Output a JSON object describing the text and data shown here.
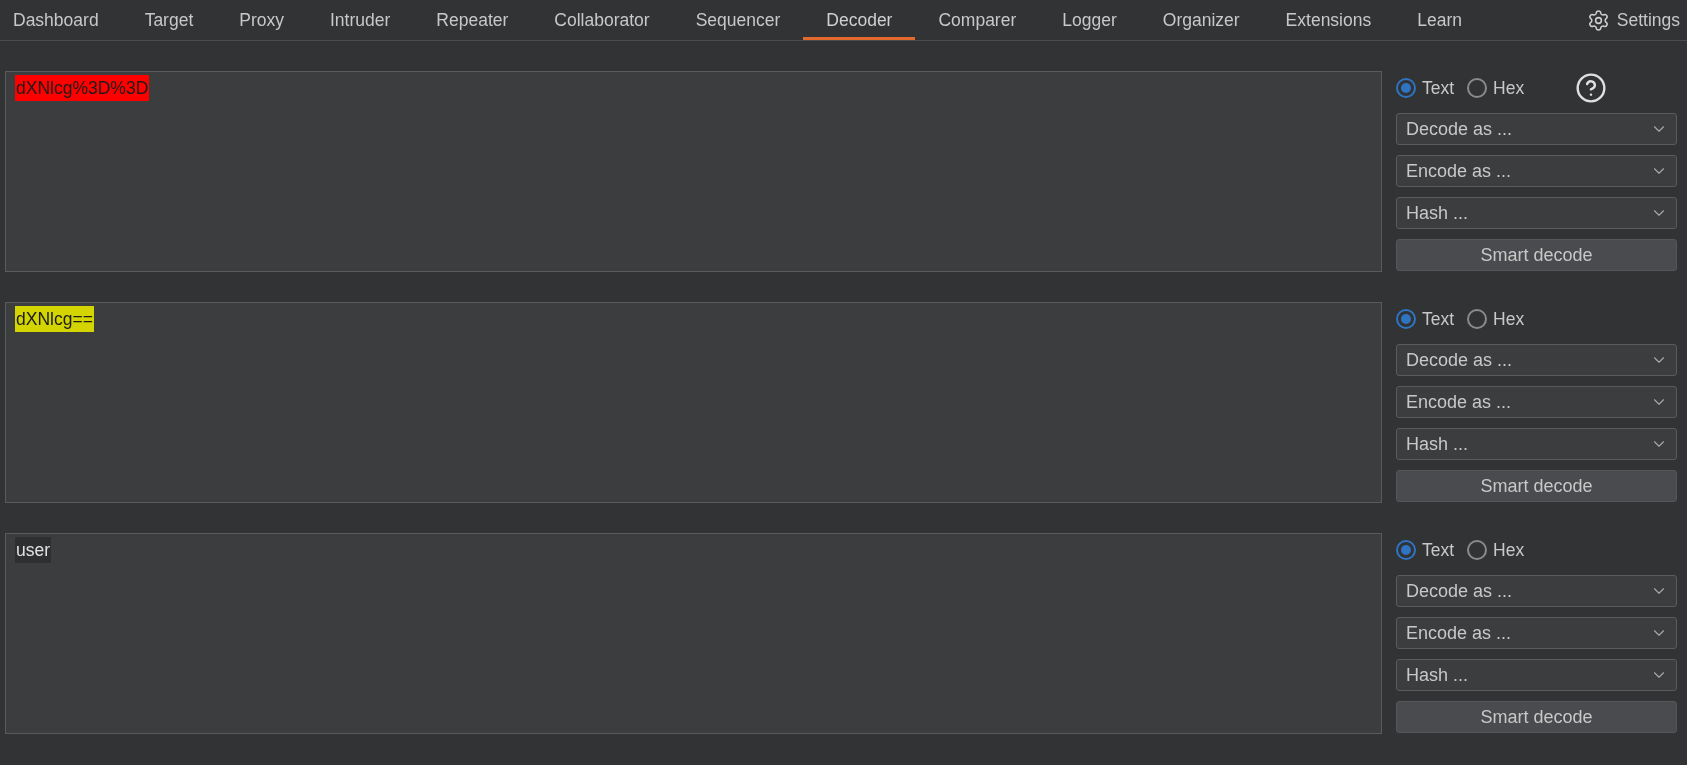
{
  "tabs": [
    {
      "label": "Dashboard",
      "selected": false
    },
    {
      "label": "Target",
      "selected": false
    },
    {
      "label": "Proxy",
      "selected": false
    },
    {
      "label": "Intruder",
      "selected": false
    },
    {
      "label": "Repeater",
      "selected": false
    },
    {
      "label": "Collaborator",
      "selected": false
    },
    {
      "label": "Sequencer",
      "selected": false
    },
    {
      "label": "Decoder",
      "selected": true
    },
    {
      "label": "Comparer",
      "selected": false
    },
    {
      "label": "Logger",
      "selected": false
    },
    {
      "label": "Organizer",
      "selected": false
    },
    {
      "label": "Extensions",
      "selected": false
    },
    {
      "label": "Learn",
      "selected": false
    }
  ],
  "settings": {
    "label": "Settings"
  },
  "panels": [
    {
      "content": "dXNlcg%3D%3D",
      "color": "#ff0000",
      "help": true,
      "formats": [
        {
          "label": "Text",
          "selected": true
        },
        {
          "label": "Hex",
          "selected": false
        }
      ],
      "dropdowns": [
        {
          "label": "Decode as ..."
        },
        {
          "label": "Encode as ..."
        },
        {
          "label": "Hash ..."
        }
      ],
      "button": "Smart decode"
    },
    {
      "content": "dXNlcg==",
      "color": "#d4d400",
      "formats": [
        {
          "label": "Text",
          "selected": true
        },
        {
          "label": "Hex",
          "selected": false
        }
      ],
      "dropdowns": [
        {
          "label": "Decode as ..."
        },
        {
          "label": "Encode as ..."
        },
        {
          "label": "Hash ..."
        }
      ],
      "button": "Smart decode"
    },
    {
      "content": "user",
      "color": "#2e2f31",
      "formats": [
        {
          "label": "Text",
          "selected": true
        },
        {
          "label": "Hex",
          "selected": false
        }
      ],
      "dropdowns": [
        {
          "label": "Decode as ..."
        },
        {
          "label": "Encode as ..."
        },
        {
          "label": "Hash ..."
        }
      ],
      "button": "Smart decode"
    }
  ]
}
